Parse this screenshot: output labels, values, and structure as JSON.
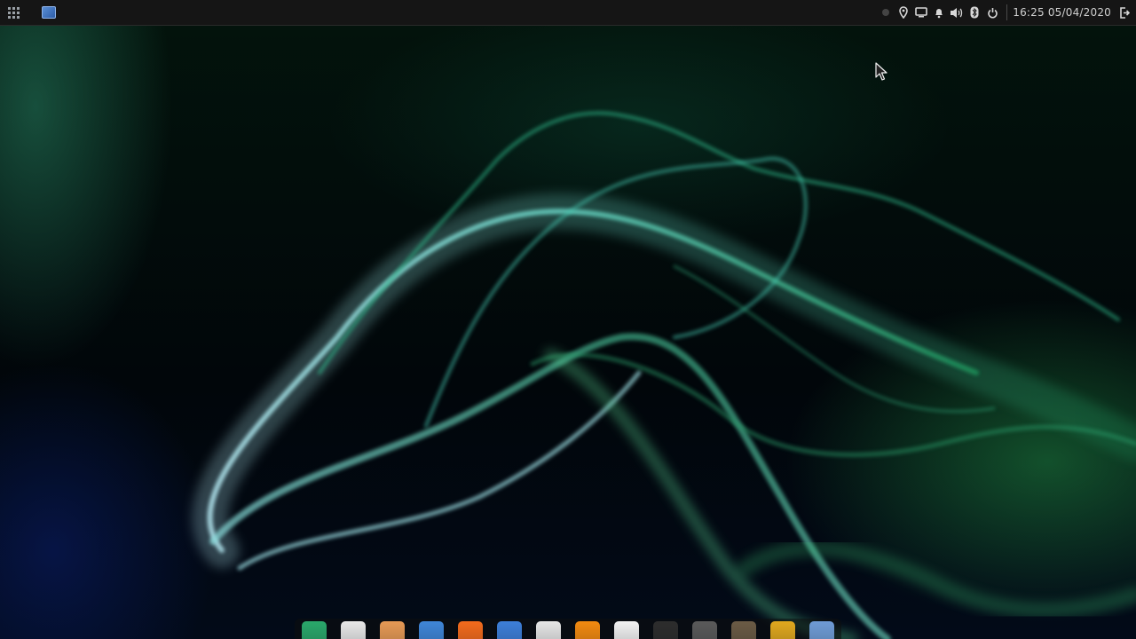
{
  "top_panel": {
    "clock": "16:25 05/04/2020",
    "tray_icons": [
      "record-dot-icon",
      "location-pin-icon",
      "screen-icon",
      "bell-icon",
      "volume-icon",
      "bluetooth-icon",
      "power-icon"
    ]
  },
  "dock": {
    "items": [
      {
        "name": "mintinstall-icon",
        "color": "#2aa86b"
      },
      {
        "name": "briefcase-icon",
        "color": "#e8e8e8"
      },
      {
        "name": "archive-icon",
        "color": "#e79a55"
      },
      {
        "name": "files-icon",
        "color": "#3f86d8"
      },
      {
        "name": "firefox-icon",
        "color": "#f36b1c"
      },
      {
        "name": "thunderbird-icon",
        "color": "#3d7fd9"
      },
      {
        "name": "text-editor-icon",
        "color": "#e6e6e6"
      },
      {
        "name": "vlc-icon",
        "color": "#f28a10"
      },
      {
        "name": "document-icon",
        "color": "#f2f2f2"
      },
      {
        "name": "terminal-icon",
        "color": "#2d2d2d"
      },
      {
        "name": "home-icon",
        "color": "#5a5a5a"
      },
      {
        "name": "gimp-icon",
        "color": "#6b5b45"
      },
      {
        "name": "update-manager-icon",
        "color": "#e0a81e"
      },
      {
        "name": "desktop-icon",
        "color": "#6f9bd6"
      }
    ]
  }
}
